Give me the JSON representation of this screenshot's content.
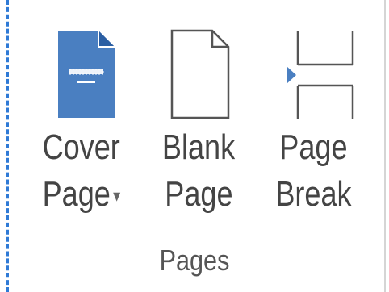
{
  "ribbon_group": {
    "name": "Pages",
    "buttons": {
      "cover_page": {
        "line1": "Cover",
        "line2": "Page",
        "has_dropdown": true,
        "icon": "cover-page-icon",
        "caret": "▾"
      },
      "blank_page": {
        "line1": "Blank",
        "line2": "Page",
        "icon": "blank-page-icon"
      },
      "page_break": {
        "line1": "Page",
        "line2": "Break",
        "icon": "page-break-icon"
      }
    }
  },
  "colors": {
    "accent": "#4a7fc1",
    "outline": "#555555",
    "text": "#444444",
    "dashed_border": "#2f7ad6"
  }
}
